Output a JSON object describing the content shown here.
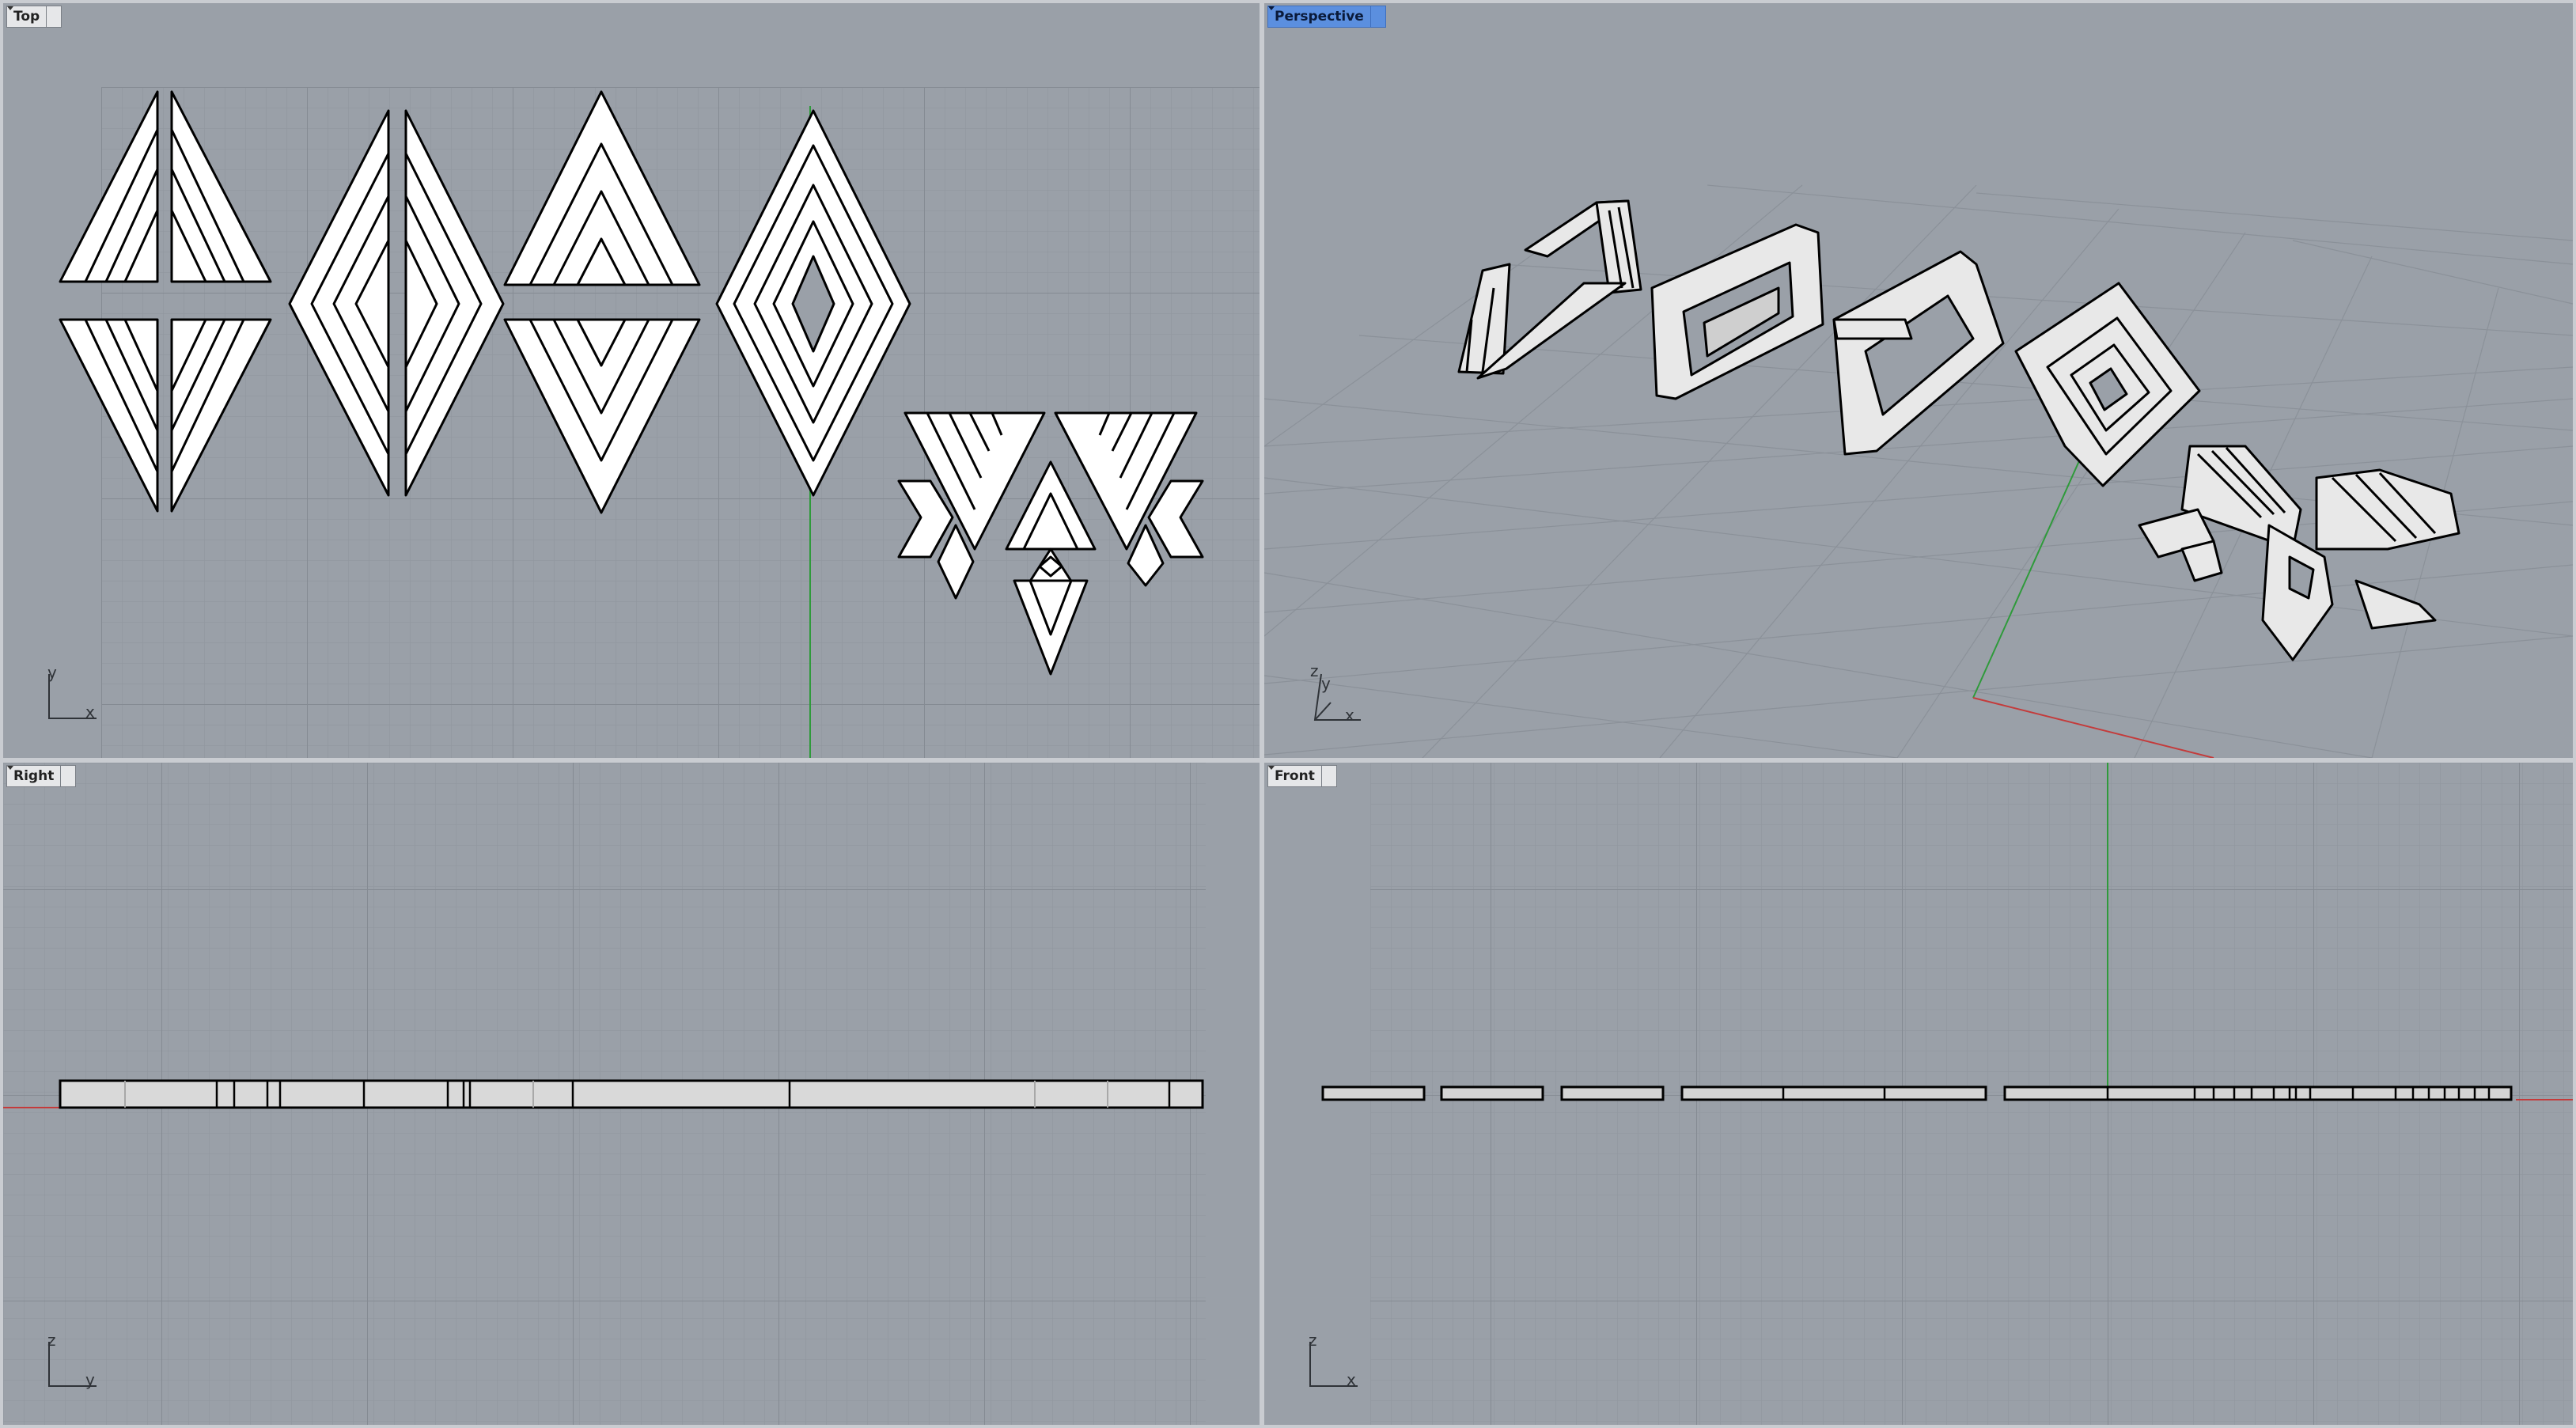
{
  "viewports": {
    "top": {
      "label": "Top",
      "axis_v": "y",
      "axis_h": "x"
    },
    "perspective": {
      "label": "Perspective",
      "axis_v": "z",
      "axis_v2": "y",
      "axis_h": "x"
    },
    "right": {
      "label": "Right",
      "axis_v": "z",
      "axis_h": "y"
    },
    "front": {
      "label": "Front",
      "axis_v": "z",
      "axis_h": "x"
    }
  },
  "icons": {
    "dropdown": "chevron-down-icon"
  },
  "colors": {
    "viewport_bg": "#9aa0a8",
    "grid_minor": "#8f959d",
    "grid_major": "#858b93",
    "active_tab": "#5b8fdf",
    "y_axis": "#2f9a3b",
    "x_axis": "#c43b3b",
    "object_fill": "#ffffff",
    "object_stroke": "#000000"
  }
}
